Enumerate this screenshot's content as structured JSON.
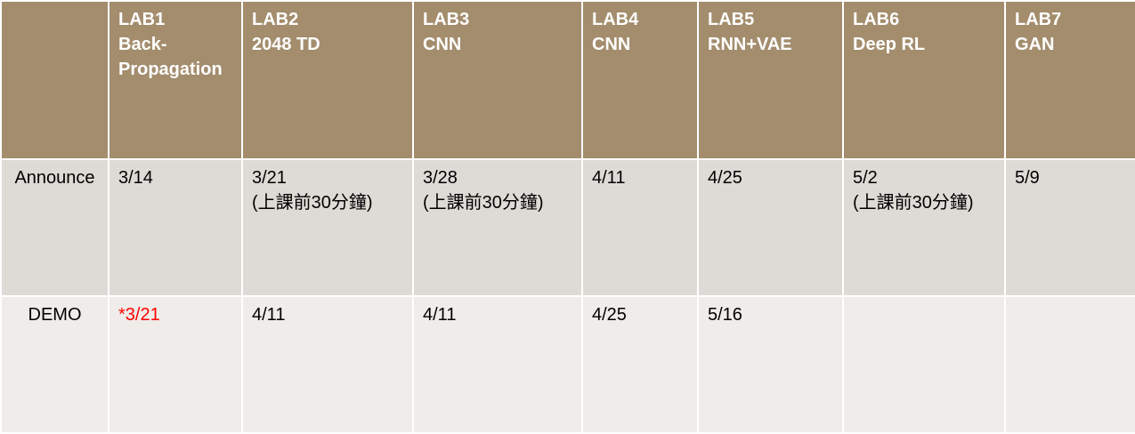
{
  "header": {
    "corner": "",
    "columns": [
      {
        "title": "LAB1",
        "lines": [
          "Back-",
          "Propagation"
        ]
      },
      {
        "title": "LAB2",
        "lines": [
          "2048 TD"
        ]
      },
      {
        "title": "LAB3",
        "lines": [
          "CNN"
        ]
      },
      {
        "title": "LAB4",
        "lines": [
          "CNN"
        ]
      },
      {
        "title": "LAB5",
        "lines": [
          "RNN+VAE"
        ]
      },
      {
        "title": "LAB6",
        "lines": [
          "Deep RL"
        ]
      },
      {
        "title": "LAB7",
        "lines": [
          "GAN"
        ]
      }
    ]
  },
  "rows": {
    "announce": {
      "label": "Announce",
      "cells": [
        {
          "date": "3/14",
          "note": ""
        },
        {
          "date": "3/21",
          "note": "(上課前30分鐘)"
        },
        {
          "date": "3/28",
          "note": "(上課前30分鐘)"
        },
        {
          "date": "4/11",
          "note": ""
        },
        {
          "date": "4/25",
          "note": ""
        },
        {
          "date": "5/2",
          "note": "(上課前30分鐘)"
        },
        {
          "date": "5/9",
          "note": ""
        }
      ]
    },
    "demo": {
      "label": "DEMO",
      "cells": [
        {
          "date": "*3/21",
          "highlight": true
        },
        {
          "date": "4/11"
        },
        {
          "date": "4/11"
        },
        {
          "date": "4/25"
        },
        {
          "date": "5/16"
        },
        {
          "date": ""
        },
        {
          "date": ""
        }
      ]
    }
  },
  "colors": {
    "header_bg": "#a38d6d",
    "announce_bg": "#dedbd6",
    "demo_bg": "#efece9",
    "highlight_text": "#ff0000"
  }
}
